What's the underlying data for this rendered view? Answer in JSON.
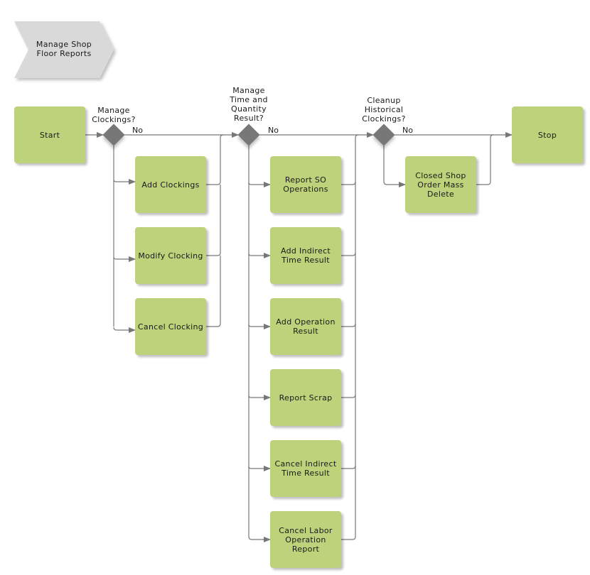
{
  "diagram": {
    "title": "Manage Shop Floor Reports",
    "colors": {
      "task_fill": "#bdd27b",
      "decision_fill": "#777777",
      "connector": "#777777",
      "header_fill": "#d9d9d9"
    },
    "start": "Start",
    "stop": "Stop",
    "decisions": [
      {
        "id": "d1",
        "label": "Manage\nClockings?",
        "no_label": "No"
      },
      {
        "id": "d2",
        "label": "Manage\nTime and\nQuantity\nResult?",
        "no_label": "No"
      },
      {
        "id": "d3",
        "label": "Cleanup\nHistorical\nClockings?",
        "no_label": "No"
      }
    ],
    "group1": [
      "Add Clockings",
      "Modify Clocking",
      "Cancel Clocking"
    ],
    "group2": [
      "Report SO\nOperations",
      "Add Indirect\nTime Result",
      "Add Operation\nResult",
      "Report Scrap",
      "Cancel Indirect\nTime Result",
      "Cancel Labor\nOperation\nReport"
    ],
    "group3": [
      "Closed Shop\nOrder Mass\nDelete"
    ]
  }
}
